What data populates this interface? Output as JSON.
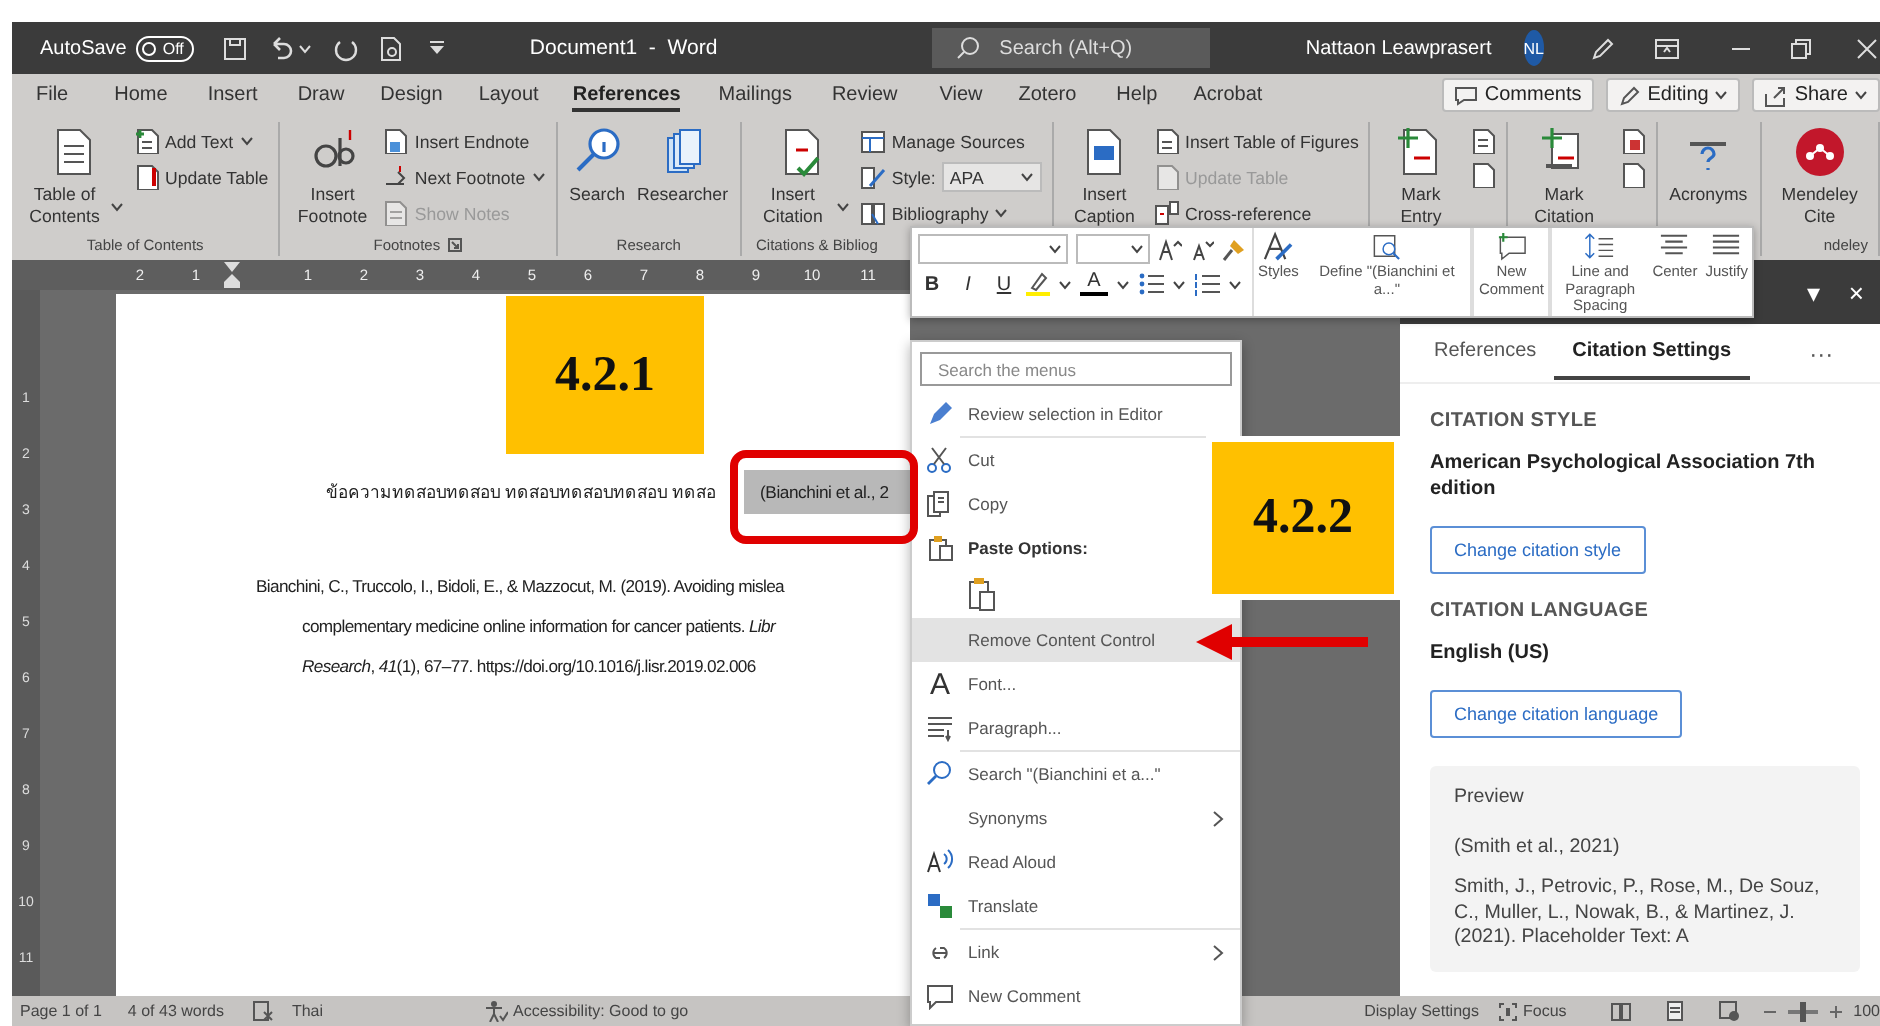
{
  "title_bar": {
    "autosave": {
      "label": "AutoSave",
      "state_text": "Off",
      "on": false
    },
    "document_title": "Document1  -  Word",
    "search": {
      "placeholder": "Search (Alt+Q)"
    },
    "user": {
      "name": "Nattaon Leawprasert",
      "initials": "NL"
    }
  },
  "menu_tabs": [
    {
      "label": "File",
      "selected": false
    },
    {
      "label": "Home",
      "selected": false
    },
    {
      "label": "Insert",
      "selected": false
    },
    {
      "label": "Draw",
      "selected": false
    },
    {
      "label": "Design",
      "selected": false
    },
    {
      "label": "Layout",
      "selected": false
    },
    {
      "label": "References",
      "selected": true
    },
    {
      "label": "Mailings",
      "selected": false
    },
    {
      "label": "Review",
      "selected": false
    },
    {
      "label": "View",
      "selected": false
    },
    {
      "label": "Zotero",
      "selected": false
    },
    {
      "label": "Help",
      "selected": false
    },
    {
      "label": "Acrobat",
      "selected": false
    }
  ],
  "ribbon_buttons": [
    {
      "label": "Comments",
      "dropdown": false
    },
    {
      "label": "Editing",
      "dropdown": true
    },
    {
      "label": "Share",
      "dropdown": true
    }
  ],
  "ribbon_groups": [
    {
      "label": "Table of Contents",
      "launcher": false,
      "items": [
        {
          "kind": "large",
          "label": "Table of Contents",
          "dropdown": true,
          "disabled": false
        },
        {
          "kind": "small",
          "label": "Add Text",
          "dropdown": true,
          "disabled": false
        },
        {
          "kind": "small",
          "label": "Update Table",
          "dropdown": false,
          "disabled": false
        }
      ]
    },
    {
      "label": "Footnotes",
      "launcher": true,
      "items": [
        {
          "kind": "large",
          "label": "Insert Footnote",
          "dropdown": false,
          "disabled": false
        },
        {
          "kind": "small",
          "label": "Insert Endnote",
          "dropdown": false,
          "disabled": false
        },
        {
          "kind": "small",
          "label": "Next Footnote",
          "dropdown": true,
          "disabled": false
        },
        {
          "kind": "small",
          "label": "Show Notes",
          "dropdown": false,
          "disabled": true
        }
      ]
    },
    {
      "label": "Research",
      "launcher": false,
      "items": [
        {
          "kind": "large",
          "label": "Search",
          "dropdown": false,
          "disabled": false
        },
        {
          "kind": "large",
          "label": "Researcher",
          "dropdown": false,
          "disabled": false
        }
      ]
    },
    {
      "label": "Citations & Bibliog",
      "launcher": false,
      "items": [
        {
          "kind": "large",
          "label": "Insert Citation",
          "dropdown": true,
          "disabled": false
        },
        {
          "kind": "small",
          "label": "Manage Sources",
          "dropdown": false,
          "disabled": false
        },
        {
          "kind": "select",
          "label": "Style:",
          "value": "APA",
          "dropdown": true,
          "disabled": false
        },
        {
          "kind": "small",
          "label": "Bibliography",
          "dropdown": true,
          "disabled": false
        }
      ]
    },
    {
      "launcher": false,
      "items": [
        {
          "kind": "large",
          "label": "Insert Caption",
          "dropdown": false,
          "disabled": false
        },
        {
          "kind": "small",
          "label": "Insert Table of Figures",
          "dropdown": false,
          "disabled": false
        },
        {
          "kind": "small",
          "label": "Update Table",
          "dropdown": false,
          "disabled": true
        },
        {
          "kind": "small",
          "label": "Cross-reference",
          "dropdown": false,
          "disabled": false
        }
      ]
    },
    {
      "launcher": false,
      "items": [
        {
          "kind": "large",
          "label": "Mark Entry",
          "dropdown": false,
          "disabled": false
        },
        {
          "kind": "icons"
        }
      ]
    },
    {
      "launcher": false,
      "items": [
        {
          "kind": "large",
          "label": "Mark Citation",
          "dropdown": false,
          "disabled": false
        },
        {
          "kind": "icons"
        }
      ]
    },
    {
      "launcher": false,
      "items": [
        {
          "kind": "large",
          "label": "Acronyms",
          "dropdown": false,
          "disabled": false
        }
      ]
    },
    {
      "label": "ndeley",
      "launcher": false,
      "items": [
        {
          "kind": "large",
          "label": "Mendeley Cite",
          "dropdown": false,
          "disabled": false
        }
      ]
    }
  ],
  "ruler": {
    "ticks": [
      "2",
      "1",
      "1",
      "2",
      "3",
      "4",
      "5",
      "6",
      "7",
      "8",
      "9",
      "10",
      "11"
    ]
  },
  "vertical_ruler": {
    "ticks": [
      "1",
      "2",
      "3",
      "4",
      "5",
      "6",
      "7",
      "8",
      "9",
      "10",
      "11"
    ]
  },
  "document": {
    "sentence": "ข้อความทดสอบทดสอบ ทดสอบทดสอบทดสอบ ทดสอ",
    "citation": "(Bianchini et al., 2",
    "reference_lines": [
      "Bianchini, C., Truccolo, I., Bidoli, E., & Mazzocut, M. (2019). Avoiding mislea",
      "complementary medicine online information for cancer patients. *Libr*",
      "*Research*, *41*(1), 67–77. https://doi.org/10.1016/j.lisr.2019.02.006"
    ]
  },
  "callouts": [
    {
      "label": "4.2.1"
    },
    {
      "label": "4.2.2"
    }
  ],
  "mini_toolbar": {
    "format_buttons": [
      {
        "label": "B"
      },
      {
        "label": "I"
      },
      {
        "label": "U"
      }
    ],
    "font_color": {
      "label": "A"
    },
    "buttons": [
      {
        "label": "Styles"
      },
      {
        "label": "Define \"(Bianchini et a...\""
      },
      {
        "label": "New Comment"
      },
      {
        "label": "Line and Paragraph Spacing"
      },
      {
        "label": "Center"
      },
      {
        "label": "Justify"
      }
    ]
  },
  "context_menu": {
    "search_placeholder": "Search the menus",
    "items": [
      {
        "kind": "item",
        "label": "Review selection in Editor",
        "selected": false,
        "submenu": false
      },
      {
        "kind": "separator"
      },
      {
        "kind": "item",
        "label": "Cut",
        "selected": false,
        "submenu": false
      },
      {
        "kind": "item",
        "label": "Copy",
        "selected": false,
        "submenu": false
      },
      {
        "kind": "header",
        "label": "Paste Options:"
      },
      {
        "kind": "paste"
      },
      {
        "kind": "item",
        "label": "Remove Content Control",
        "selected": true,
        "submenu": false
      },
      {
        "kind": "item",
        "label": "Font...",
        "glyph": "A",
        "selected": false,
        "submenu": false
      },
      {
        "kind": "item",
        "label": "Paragraph...",
        "selected": false,
        "submenu": false
      },
      {
        "kind": "separator"
      },
      {
        "kind": "item",
        "label": "Search \"(Bianchini et a...\"",
        "selected": false,
        "submenu": false
      },
      {
        "kind": "item",
        "label": "Synonyms",
        "selected": false,
        "submenu": true
      },
      {
        "kind": "item",
        "label": "Read Aloud",
        "selected": false,
        "submenu": false
      },
      {
        "kind": "item",
        "label": "Translate",
        "selected": false,
        "submenu": false
      },
      {
        "kind": "separator"
      },
      {
        "kind": "item",
        "label": "Link",
        "selected": false,
        "submenu": true
      },
      {
        "kind": "item",
        "label": "New Comment",
        "selected": false,
        "submenu": false
      }
    ]
  },
  "task_pane": {
    "header_buttons": [
      "▾",
      "×"
    ],
    "tabs": [
      {
        "label": "References",
        "selected": false
      },
      {
        "label": "Citation Settings",
        "selected": true
      }
    ],
    "more": "···",
    "sections": [
      {
        "heading": "CITATION STYLE",
        "value": "American Psychological Association 7th edition",
        "button": "Change citation style"
      },
      {
        "heading": "CITATION LANGUAGE",
        "value": "English (US)",
        "button": "Change citation language"
      }
    ],
    "preview": {
      "title": "Preview",
      "citation": "(Smith et al., 2021)",
      "reference": "Smith, J., Petrovic, P., Rose, M., De Souz, C., Muller, L., Nowak, B., & Martinez, J. (2021). Placeholder Text: A"
    }
  },
  "status_bar": {
    "page": "Page 1 of 1",
    "words": "4 of 43 words",
    "language": "Thai",
    "accessibility": "Accessibility: Good to go",
    "display_settings": "Display Settings",
    "focus": "Focus",
    "zoom": {
      "level": 0.5,
      "text": "100"
    }
  }
}
